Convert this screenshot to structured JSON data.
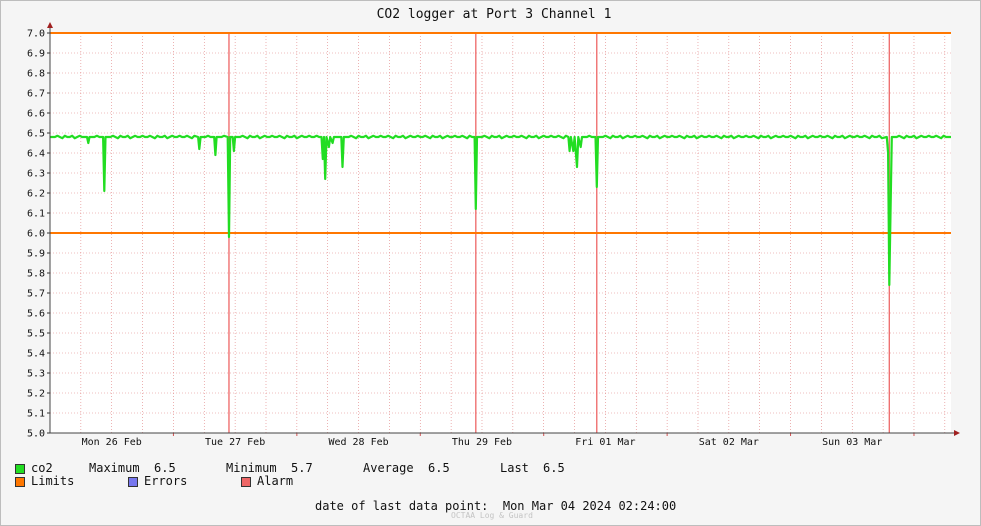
{
  "chart_data": {
    "type": "line",
    "title": "CO2 logger at Port 3 Channel 1",
    "ylim": [
      5.0,
      7.0
    ],
    "y_ticks": [
      "5.0",
      "5.1",
      "5.2",
      "5.3",
      "5.4",
      "5.5",
      "5.6",
      "5.7",
      "5.8",
      "5.9",
      "6.0",
      "6.1",
      "6.2",
      "6.3",
      "6.4",
      "6.5",
      "6.6",
      "6.7",
      "6.8",
      "6.9",
      "7.0"
    ],
    "xlim_days": [
      0,
      7.3
    ],
    "x_ticks": [
      {
        "label": "Mon 26 Feb",
        "day": 0.5
      },
      {
        "label": "Tue 27 Feb",
        "day": 1.5
      },
      {
        "label": "Wed 28 Feb",
        "day": 2.5
      },
      {
        "label": "Thu 29 Feb",
        "day": 3.5
      },
      {
        "label": "Fri 01 Mar",
        "day": 4.5
      },
      {
        "label": "Sat 02 Mar",
        "day": 5.5
      },
      {
        "label": "Sun 03 Mar",
        "day": 6.5
      }
    ],
    "limits": [
      6.0,
      7.0
    ],
    "alarm_days": [
      1.45,
      3.45,
      4.43,
      6.8
    ],
    "series": [
      {
        "name": "co2",
        "color": "#22dd22",
        "baseline": 6.48,
        "points": [
          [
            0.0,
            6.48
          ],
          [
            0.3,
            6.48
          ],
          [
            0.31,
            6.45
          ],
          [
            0.32,
            6.48
          ],
          [
            0.43,
            6.48
          ],
          [
            0.44,
            6.21
          ],
          [
            0.45,
            6.48
          ],
          [
            1.2,
            6.48
          ],
          [
            1.21,
            6.42
          ],
          [
            1.22,
            6.48
          ],
          [
            1.33,
            6.48
          ],
          [
            1.34,
            6.39
          ],
          [
            1.35,
            6.48
          ],
          [
            1.44,
            6.48
          ],
          [
            1.45,
            5.98
          ],
          [
            1.46,
            6.48
          ],
          [
            1.48,
            6.48
          ],
          [
            1.49,
            6.41
          ],
          [
            1.5,
            6.48
          ],
          [
            2.2,
            6.48
          ],
          [
            2.21,
            6.37
          ],
          [
            2.22,
            6.48
          ],
          [
            2.23,
            6.27
          ],
          [
            2.24,
            6.48
          ],
          [
            2.26,
            6.43
          ],
          [
            2.27,
            6.48
          ],
          [
            2.29,
            6.45
          ],
          [
            2.3,
            6.48
          ],
          [
            2.36,
            6.48
          ],
          [
            2.37,
            6.33
          ],
          [
            2.38,
            6.48
          ],
          [
            3.44,
            6.48
          ],
          [
            3.45,
            6.12
          ],
          [
            3.46,
            6.48
          ],
          [
            4.2,
            6.48
          ],
          [
            4.21,
            6.41
          ],
          [
            4.22,
            6.48
          ],
          [
            4.24,
            6.41
          ],
          [
            4.25,
            6.48
          ],
          [
            4.27,
            6.33
          ],
          [
            4.28,
            6.48
          ],
          [
            4.3,
            6.43
          ],
          [
            4.31,
            6.48
          ],
          [
            4.42,
            6.48
          ],
          [
            4.43,
            6.23
          ],
          [
            4.44,
            6.48
          ],
          [
            6.78,
            6.48
          ],
          [
            6.79,
            6.4
          ],
          [
            6.8,
            5.74
          ],
          [
            6.81,
            6.1
          ],
          [
            6.82,
            6.48
          ],
          [
            7.3,
            6.48
          ]
        ]
      }
    ]
  },
  "legend": {
    "co2_label": "co2",
    "maximum_label": "Maximum",
    "maximum_value": "6.5",
    "minimum_label": "Minimum",
    "minimum_value": "5.7",
    "average_label": "Average",
    "average_value": "6.5",
    "last_label": "Last",
    "last_value": "6.5",
    "limits_label": "Limits",
    "errors_label": "Errors",
    "alarm_label": "Alarm",
    "colors": {
      "co2": "#22dd22",
      "limits": "#ff7700",
      "errors": "#7777ee",
      "alarm": "#ee6666"
    }
  },
  "footer": {
    "label": "date of last data point:",
    "value": "Mon Mar 04 2024 02:24:00"
  },
  "watermark": "OCTAA Log & Guard"
}
